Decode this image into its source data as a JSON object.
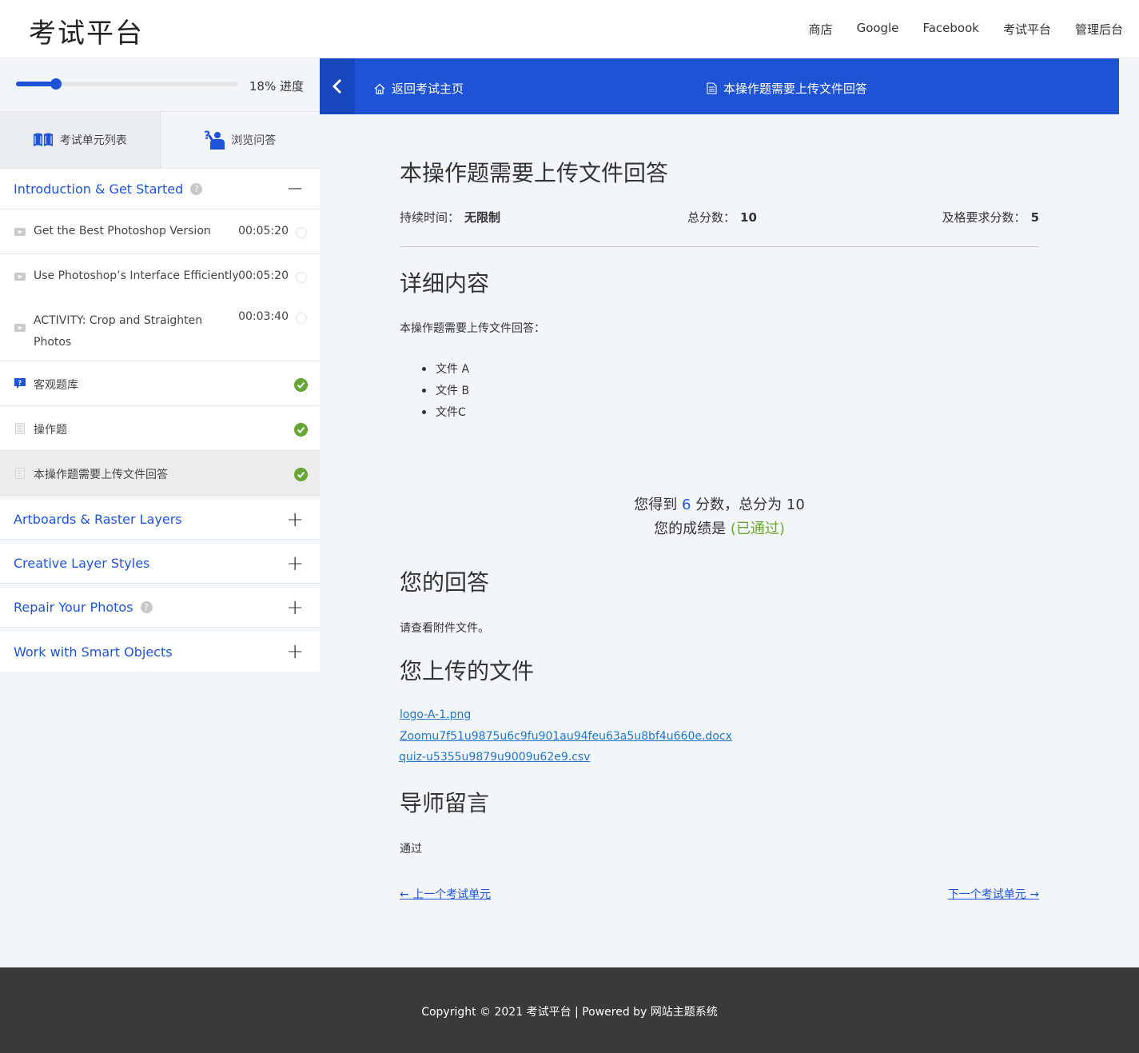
{
  "header": {
    "site_title": "考试平台",
    "nav": [
      "商店",
      "Google",
      "Facebook",
      "考试平台",
      "管理后台"
    ]
  },
  "sidebar": {
    "progress_value": 18,
    "progress_label": "18% 进度",
    "tabs": [
      {
        "label": "考试单元列表",
        "icon": "book-icon"
      },
      {
        "label": "浏览问答",
        "icon": "question-person-icon"
      }
    ],
    "sections": [
      {
        "title": "Introduction & Get Started",
        "has_help": true,
        "expanded": true,
        "lessons": [
          {
            "title": "Get the Best Photoshop Version",
            "time": "00:05:20",
            "icon": "video-icon",
            "done": false
          },
          {
            "title": "Use Photoshop’s Interface Efficiently",
            "time": "00:05:20",
            "icon": "video-icon",
            "done": false
          },
          {
            "title": "ACTIVITY: Crop and Straighten Photos",
            "time": "00:03:40",
            "icon": "video-icon",
            "done": false
          },
          {
            "title": "客观题库",
            "time": "",
            "icon": "quiz-icon",
            "done": true
          },
          {
            "title": "操作题",
            "time": "",
            "icon": "document-icon",
            "done": true
          },
          {
            "title": "本操作题需要上传文件回答",
            "time": "",
            "icon": "document-icon",
            "done": true
          }
        ]
      },
      {
        "title": "Artboards & Raster Layers",
        "has_help": false,
        "expanded": false
      },
      {
        "title": "Creative Layer Styles",
        "has_help": false,
        "expanded": false
      },
      {
        "title": "Repair Your Photos",
        "has_help": true,
        "expanded": false
      },
      {
        "title": "Work with Smart Objects",
        "has_help": false,
        "expanded": false
      }
    ]
  },
  "topbar": {
    "back_link": "返回考试主页",
    "current_title": "本操作题需要上传文件回答"
  },
  "main": {
    "heading": "本操作题需要上传文件回答",
    "duration_label": "持续时间：",
    "duration_value": "无限制",
    "total_label": "总分数：",
    "total_value": "10",
    "pass_label": "及格要求分数：",
    "pass_value": "5",
    "details_heading": "详细内容",
    "details_intro": "本操作题需要上传文件回答：",
    "details_files": [
      "文件 A",
      "文件 B",
      "文件C"
    ],
    "result_prefix": "您得到",
    "result_score": "6",
    "result_middle": "分数，总分为",
    "result_total": "10",
    "result_grade_prefix": "您的成绩是",
    "result_grade": "(已通过)",
    "answer_heading": "您的回答",
    "answer_text": "请查看附件文件。",
    "uploads_heading": "您上传的文件",
    "uploads": [
      "logo-A-1.png",
      "Zoomu7f51u9875u6c9fu901au94feu63a5u8bf4u660e.docx",
      "quiz-u5355u9879u9009u62e9.csv"
    ],
    "mentor_heading": "导师留言",
    "mentor_text": "通过",
    "prev_label": "上一个考试单元",
    "next_label": "下一个考试单元"
  },
  "footer": {
    "text": "Copyright © 2021 考试平台 | Powered by 网站主题系统"
  },
  "colors": {
    "accent": "#1e53d6",
    "success": "#68a634",
    "link": "#2275c9",
    "footer_bg": "#3a3a3a"
  }
}
